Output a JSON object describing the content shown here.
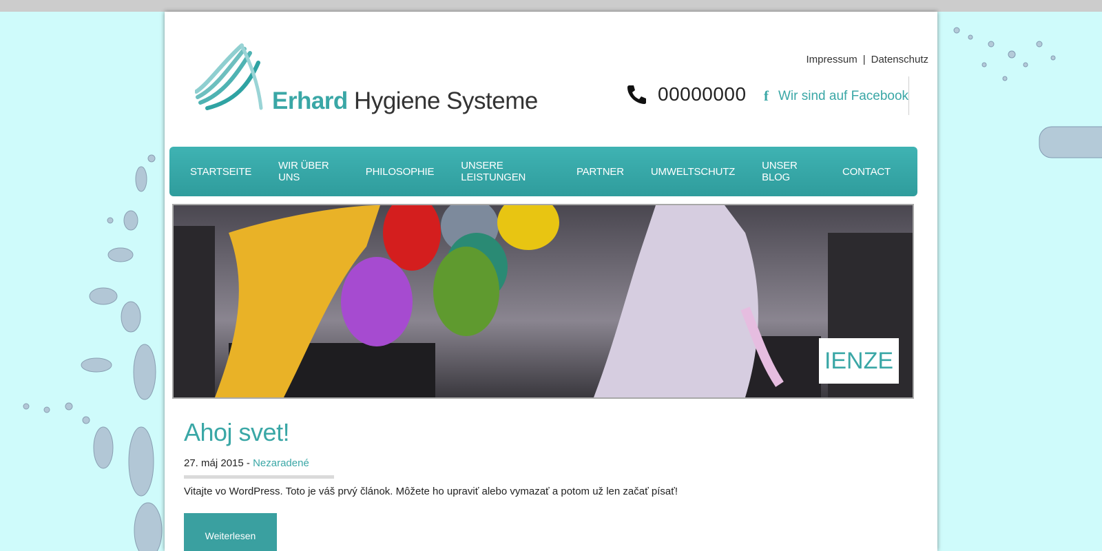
{
  "header": {
    "brand_strong": "Erhard",
    "brand_rest": "Hygiene Systeme",
    "phone": "00000000",
    "facebook": "Wir sind auf Facebook",
    "links": [
      "Impressum",
      "Datenschutz"
    ],
    "link_separator": "|"
  },
  "nav": {
    "items": [
      "STARTSEITE",
      "WIR ÜBER UNS",
      "PHILOSOPHIE",
      "UNSERE LEISTUNGEN",
      "PARTNER",
      "UMWELTSCHUTZ",
      "UNSER BLOG",
      "CONTACT"
    ]
  },
  "hero": {
    "label": "IENZE"
  },
  "post": {
    "title": "Ahoj svet!",
    "date": "27. máj 2015",
    "date_separator": " - ",
    "category": "Nezaradené",
    "excerpt": "Vitajte vo WordPress. Toto je váš prvý článok. Môžete ho upraviť alebo vymazať a potom už len začať písať!",
    "read_more": "Weiterlesen"
  },
  "colors": {
    "accent": "#3aa7a6",
    "background": "#cffbfb",
    "nav": "#35a8a8"
  },
  "icons": [
    "logo-fan-icon",
    "phone-icon",
    "facebook-icon"
  ]
}
